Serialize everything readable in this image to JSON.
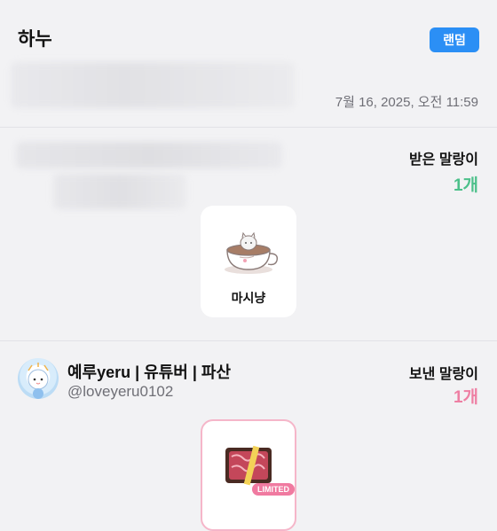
{
  "header": {
    "title": "하누",
    "random_button": "랜덤",
    "timestamp": "7월 16, 2025, 오전 11:59"
  },
  "received": {
    "label": "받은 말랑이",
    "count": "1개",
    "gift": {
      "name": "마시냥",
      "icon": "teacup-cat-icon"
    }
  },
  "sent": {
    "sender_name": "예루yeru | 유튜버 | 파산",
    "sender_handle": "@loveyeru0102",
    "label": "보낸 말랑이",
    "count": "1개",
    "gift": {
      "badge": "LIMITED",
      "icon": "meat-gift-box-icon"
    }
  },
  "colors": {
    "accent": "#2b8ff5",
    "received_count": "#4cc08a",
    "sent_count": "#ee7fa3"
  }
}
